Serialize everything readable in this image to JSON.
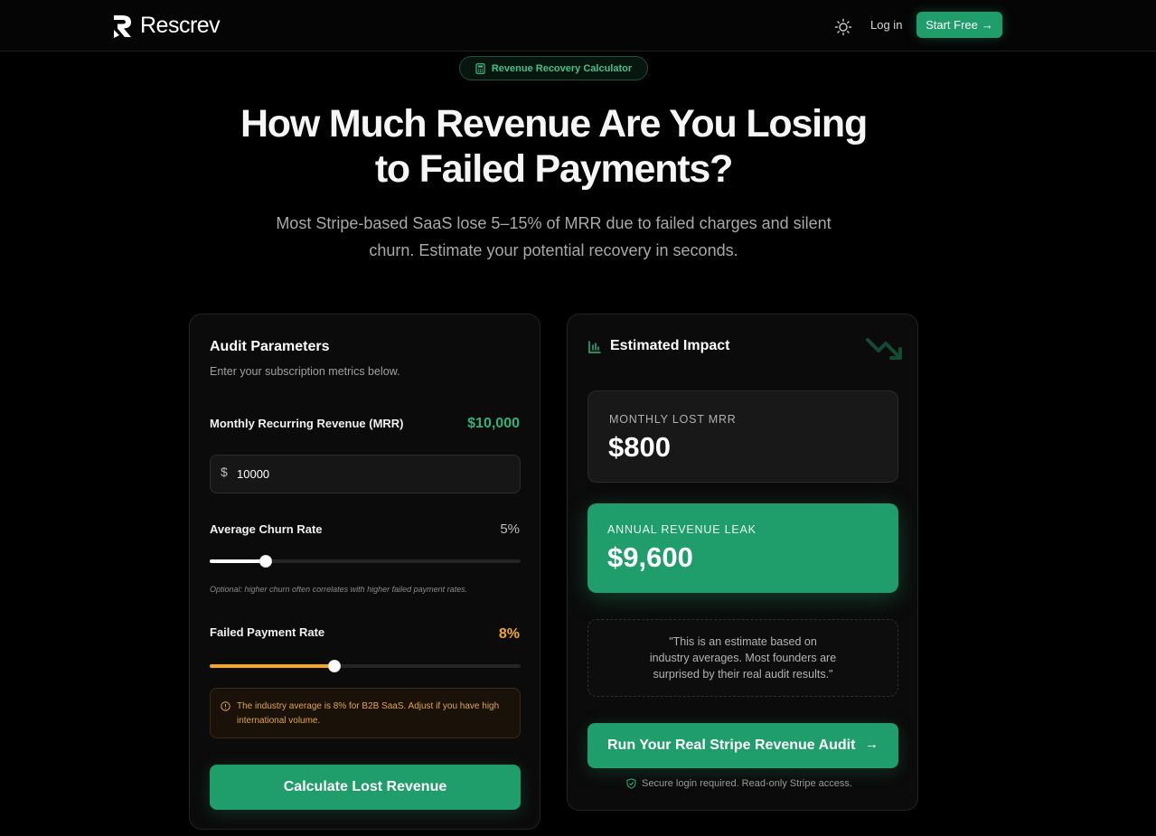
{
  "header": {
    "brand": "Rescrev",
    "login_label": "Log in",
    "start_label": "Start Free",
    "start_arrow": "→",
    "theme_icon": "sun-icon"
  },
  "hero": {
    "pill_label": "Revenue Recovery Calculator",
    "pill_icon": "calculator-icon",
    "title_line1": "How Much Revenue Are You Losing",
    "title_line2": "to Failed Payments?",
    "subtitle_line1": "Most Stripe-based SaaS lose 5–15% of MRR due to failed charges and silent",
    "subtitle_line2": "churn. Estimate your potential recovery in seconds."
  },
  "params": {
    "title": "Audit Parameters",
    "subtitle": "Enter your subscription metrics below.",
    "mrr_label": "Monthly Recurring Revenue (MRR)",
    "mrr_display": "$10,000",
    "currency_symbol": "$",
    "mrr_input_value": "10000",
    "churn_label": "Average Churn Rate",
    "churn_display": "5%",
    "churn_fraction": 0.18,
    "churn_hint": "Optional: higher churn often correlates with higher failed payment rates.",
    "failed_label": "Failed Payment Rate",
    "failed_display": "8%",
    "failed_fraction": 0.4,
    "warning_text": "The industry average is 8% for B2B SaaS. Adjust if you have high international volume.",
    "calc_button": "Calculate Lost Revenue"
  },
  "impact": {
    "title": "Estimated Impact",
    "title_icon": "bar-chart-icon",
    "monthly_label": "MONTHLY LOST MRR",
    "monthly_value": "$800",
    "annual_label": "ANNUAL REVENUE LEAK",
    "annual_value": "$9,600",
    "quote_line1": "\"This is an estimate based on",
    "quote_line2": "industry averages. Most founders are",
    "quote_line3": "surprised by their real audit results.\"",
    "audit_button": "Run Your Real Stripe Revenue Audit",
    "audit_arrow": "→",
    "secure_text": "Secure login required. Read-only Stripe access."
  },
  "colors": {
    "accent": "#1f9d6b",
    "accent_text": "#2fb37c",
    "warning": "#f5a623",
    "background": "#000000"
  }
}
